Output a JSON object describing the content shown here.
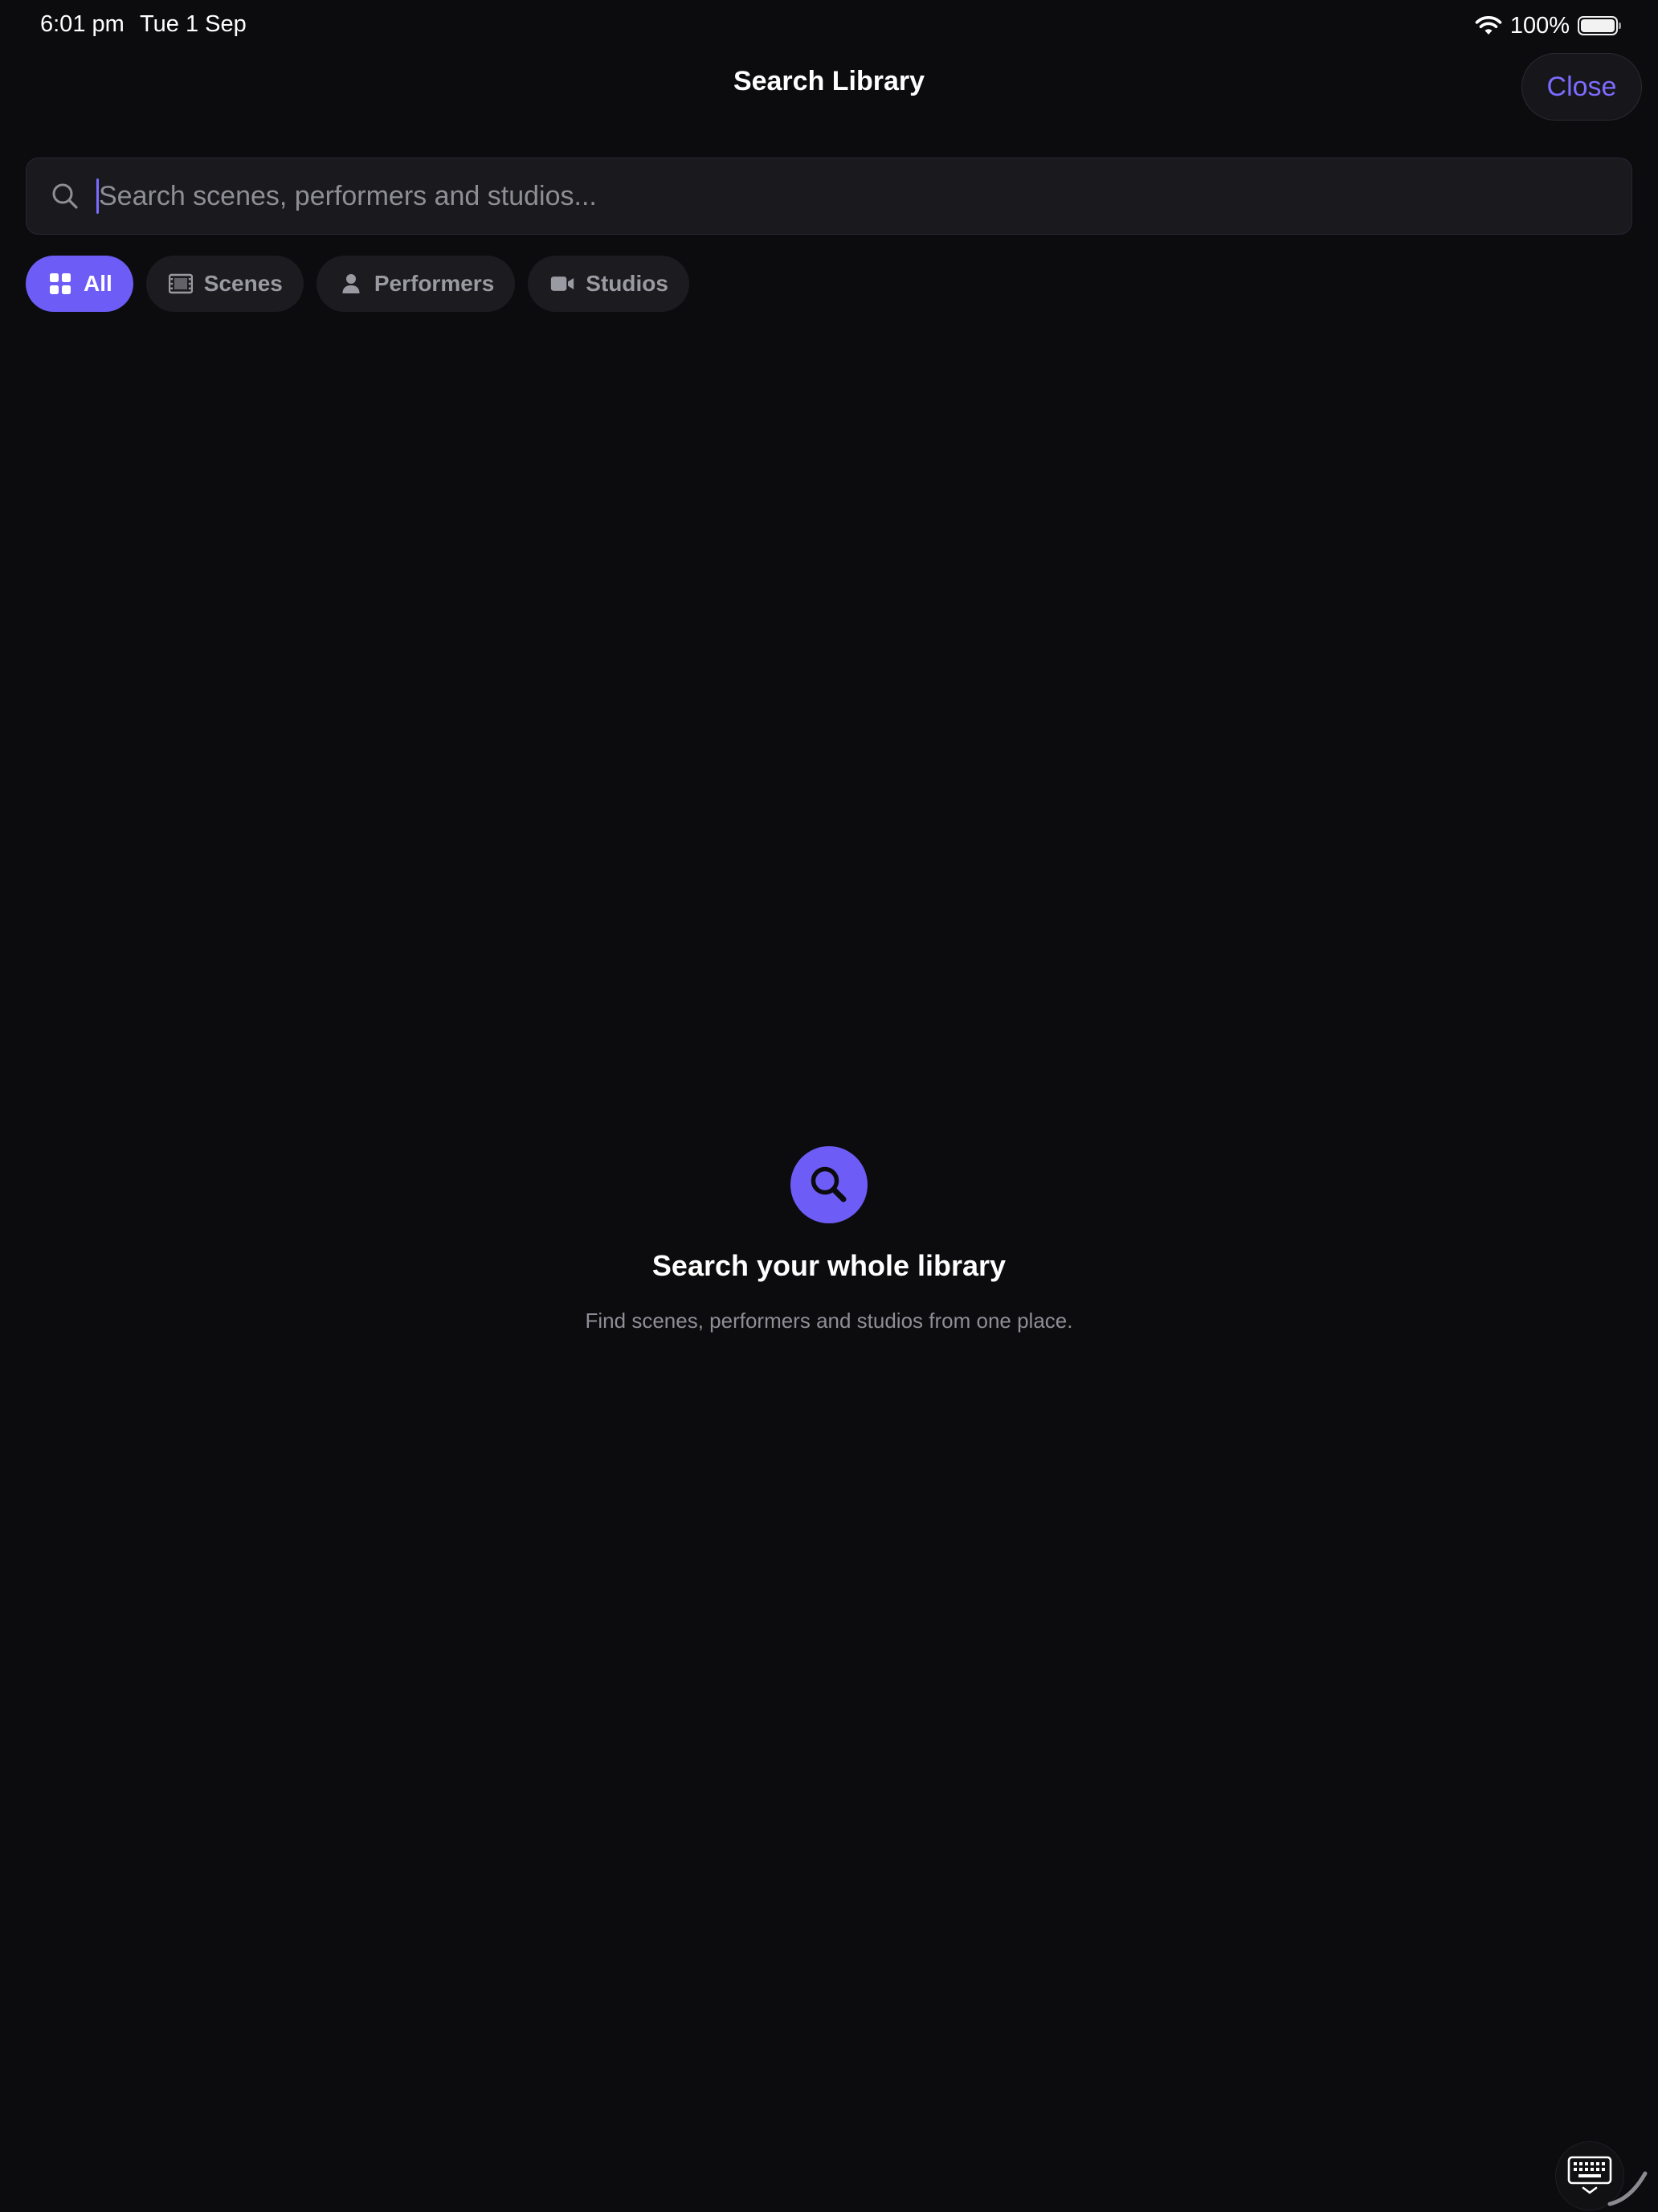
{
  "status_bar": {
    "time": "6:01 pm",
    "date": "Tue 1 Sep",
    "battery_percent": "100%",
    "icons": [
      "wifi-icon",
      "battery-icon"
    ]
  },
  "header": {
    "title": "Search Library",
    "close_label": "Close"
  },
  "search": {
    "placeholder": "Search scenes, performers and studios...",
    "value": "",
    "icon": "search-icon"
  },
  "filters": {
    "selected": "All",
    "items": [
      {
        "label": "All",
        "icon": "grid-icon",
        "active": true
      },
      {
        "label": "Scenes",
        "icon": "film-icon",
        "active": false
      },
      {
        "label": "Performers",
        "icon": "person-icon",
        "active": false
      },
      {
        "label": "Studios",
        "icon": "video-camera-icon",
        "active": false
      }
    ]
  },
  "empty_state": {
    "icon": "search-icon",
    "title": "Search your whole library",
    "subtitle": "Find scenes, performers and studios from one place."
  },
  "keyboard": {
    "icon": "keyboard-dismiss-icon"
  },
  "colors": {
    "background": "#0c0c0e",
    "accent": "#6e5cf6",
    "accent_text": "#7b6cff",
    "chip_background": "#1c1c20",
    "muted_text": "#8e8e96"
  }
}
